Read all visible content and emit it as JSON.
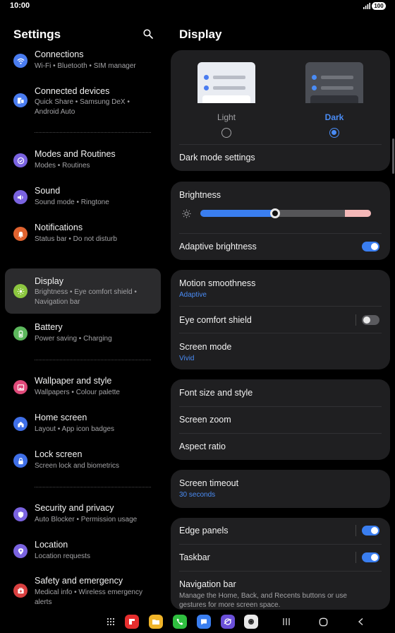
{
  "status_bar": {
    "time": "10:00",
    "battery": "100"
  },
  "left_pane": {
    "title": "Settings",
    "items": [
      {
        "title": "Connections",
        "subtitle": "Wi-Fi  •  Bluetooth  •  SIM manager",
        "icon": "wifi-icon",
        "color": "#4a7cf0"
      },
      {
        "title": "Connected devices",
        "subtitle": "Quick Share  •  Samsung DeX  •  Android Auto",
        "icon": "devices-icon",
        "color": "#4a7cf0"
      },
      {
        "title": "Modes and Routines",
        "subtitle": "Modes  •  Routines",
        "icon": "check-circle-icon",
        "color": "#7a63e0"
      },
      {
        "title": "Sound",
        "subtitle": "Sound mode  •  Ringtone",
        "icon": "speaker-icon",
        "color": "#7a63e0"
      },
      {
        "title": "Notifications",
        "subtitle": "Status bar  •  Do not disturb",
        "icon": "bell-icon",
        "color": "#e0632f"
      },
      {
        "title": "Display",
        "subtitle": "Brightness  •  Eye comfort shield  •  Navigation bar",
        "icon": "sun-icon",
        "color": "#8cc63f"
      },
      {
        "title": "Battery",
        "subtitle": "Power saving  •  Charging",
        "icon": "battery-icon",
        "color": "#5cb85c"
      },
      {
        "title": "Wallpaper and style",
        "subtitle": "Wallpapers  •  Colour palette",
        "icon": "image-icon",
        "color": "#e04a7a"
      },
      {
        "title": "Home screen",
        "subtitle": "Layout  •  App icon badges",
        "icon": "home-icon",
        "color": "#3f6fe8"
      },
      {
        "title": "Lock screen",
        "subtitle": "Screen lock and biometrics",
        "icon": "lock-icon",
        "color": "#3f6fe8"
      },
      {
        "title": "Security and privacy",
        "subtitle": "Auto Blocker  •  Permission usage",
        "icon": "shield-icon",
        "color": "#7a63e0"
      },
      {
        "title": "Location",
        "subtitle": "Location requests",
        "icon": "location-pin-icon",
        "color": "#7a63e0"
      },
      {
        "title": "Safety and emergency",
        "subtitle": "Medical info  •  Wireless emergency alerts",
        "icon": "emergency-icon",
        "color": "#d94040"
      }
    ]
  },
  "right_pane": {
    "title": "Display",
    "theme": {
      "light_label": "Light",
      "dark_label": "Dark",
      "selected": "Dark"
    },
    "dark_mode_settings": "Dark mode settings",
    "brightness": {
      "label": "Brightness",
      "level": 0.44
    },
    "adaptive_brightness": {
      "label": "Adaptive brightness",
      "on": true
    },
    "motion_smoothness": {
      "label": "Motion smoothness",
      "value": "Adaptive"
    },
    "eye_comfort_shield": {
      "label": "Eye comfort shield",
      "on": false
    },
    "screen_mode": {
      "label": "Screen mode",
      "value": "Vivid"
    },
    "font_size": "Font size and style",
    "screen_zoom": "Screen zoom",
    "aspect_ratio": "Aspect ratio",
    "screen_timeout": {
      "label": "Screen timeout",
      "value": "30 seconds"
    },
    "edge_panels": {
      "label": "Edge panels",
      "on": true
    },
    "taskbar": {
      "label": "Taskbar",
      "on": true
    },
    "navigation_bar": {
      "label": "Navigation bar",
      "description": "Manage the Home, Back, and Recents buttons or use gestures for more screen space."
    }
  },
  "dock": {
    "apps": [
      {
        "name": "app-drawer-icon",
        "color": "#000000"
      },
      {
        "name": "flipboard-icon",
        "color": "#e62e2e"
      },
      {
        "name": "folder-app-icon",
        "color": "#f0b429"
      },
      {
        "name": "phone-app-icon",
        "color": "#2fbf3f"
      },
      {
        "name": "messages-app-icon",
        "color": "#3a7ef0"
      },
      {
        "name": "internet-app-icon",
        "color": "#6a4fd8"
      },
      {
        "name": "camera-app-icon",
        "color": "#e8e8e8"
      }
    ]
  }
}
